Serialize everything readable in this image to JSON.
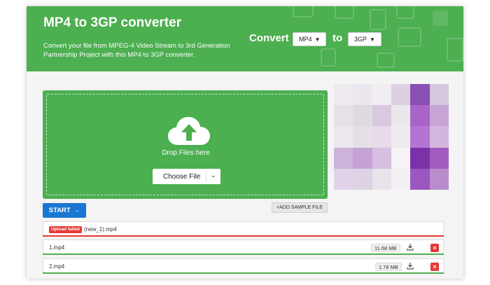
{
  "header": {
    "title": "MP4 to 3GP converter",
    "description": "Convert your file from MPEG-4 Video Stream to 3rd Generation Partnership Project with this MP4 to 3GP converter.",
    "convert_label": "Convert",
    "to_label": "to",
    "from_format": "MP4",
    "to_format": "3GP"
  },
  "dropzone": {
    "drop_text": "Drop Files here",
    "choose_label": "Choose File"
  },
  "actions": {
    "start_label": "START",
    "add_sample_label": "ADD SAMPLE FILE"
  },
  "files": [
    {
      "name": "(new_1).mp4",
      "status": "Upload failed",
      "size": ""
    },
    {
      "name": "1.mp4",
      "status": "",
      "size": "11.68 MB"
    },
    {
      "name": "2.mp4",
      "status": "",
      "size": "1.78 MB"
    }
  ],
  "colors": {
    "brand_green": "#4caf50",
    "start_blue": "#1976d2",
    "error_red": "#e53935",
    "success_green": "#4caf50"
  },
  "icons": [
    "upload-cloud-icon",
    "chevron-down-icon",
    "arrow-right-icon",
    "plus-icon",
    "download-icon",
    "close-icon"
  ]
}
